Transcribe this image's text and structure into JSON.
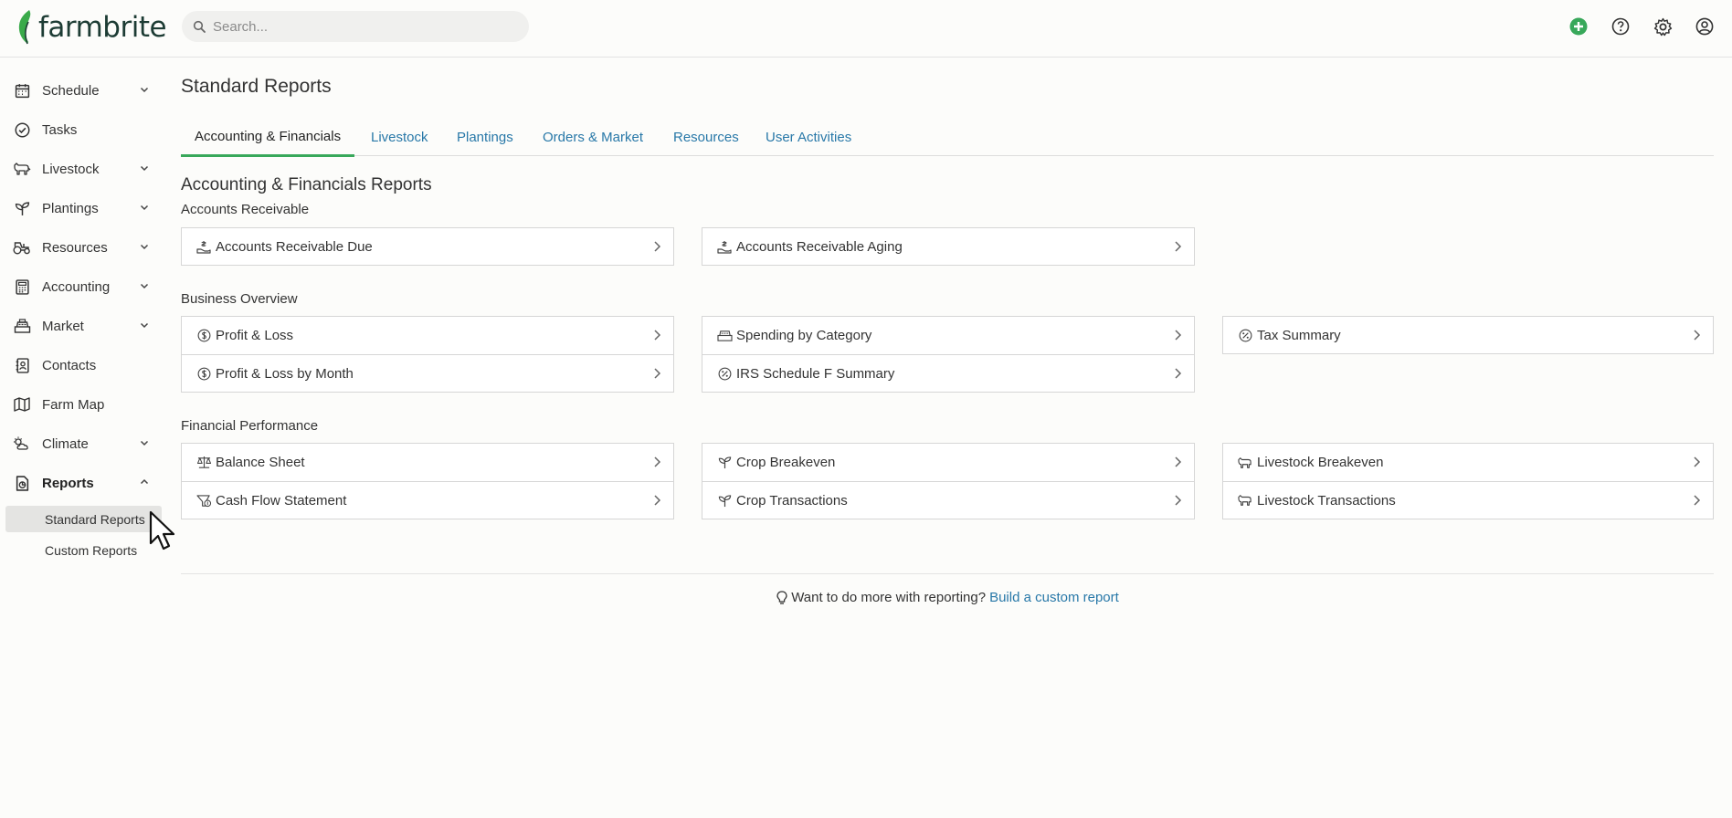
{
  "brand": {
    "name": "farmbrite",
    "leaf_color": "#3aaa4a"
  },
  "search": {
    "placeholder": "Search..."
  },
  "top_icons": [
    "add-circle-icon",
    "help-icon",
    "settings-icon",
    "user-icon"
  ],
  "sidebar": {
    "items": [
      {
        "label": "Schedule",
        "icon": "calendar-icon",
        "has_chevron": true
      },
      {
        "label": "Tasks",
        "icon": "check-circle-icon",
        "has_chevron": false
      },
      {
        "label": "Livestock",
        "icon": "livestock-icon",
        "has_chevron": true
      },
      {
        "label": "Plantings",
        "icon": "sprout-icon",
        "has_chevron": true
      },
      {
        "label": "Resources",
        "icon": "tractor-icon",
        "has_chevron": true
      },
      {
        "label": "Accounting",
        "icon": "calculator-icon",
        "has_chevron": true
      },
      {
        "label": "Market",
        "icon": "register-icon",
        "has_chevron": true
      },
      {
        "label": "Contacts",
        "icon": "contact-book-icon",
        "has_chevron": false
      },
      {
        "label": "Farm Map",
        "icon": "map-icon",
        "has_chevron": false
      },
      {
        "label": "Climate",
        "icon": "weather-icon",
        "has_chevron": true
      },
      {
        "label": "Reports",
        "icon": "report-icon",
        "has_chevron": true,
        "expanded": true
      }
    ],
    "sub_items": [
      {
        "label": "Standard Reports",
        "selected": true
      },
      {
        "label": "Custom Reports",
        "selected": false
      }
    ]
  },
  "page": {
    "title": "Standard Reports",
    "tabs": [
      {
        "label": "Accounting & Financials",
        "active": true
      },
      {
        "label": "Livestock"
      },
      {
        "label": "Plantings"
      },
      {
        "label": "Orders & Market"
      },
      {
        "label": "Resources"
      },
      {
        "label": "User Activities"
      }
    ],
    "section_title": "Accounting & Financials Reports",
    "groups": [
      {
        "title": "Accounts Receivable",
        "cards": [
          [
            {
              "label": "Accounts Receivable Due",
              "icon": "hand-money-icon"
            }
          ],
          [
            {
              "label": "Accounts Receivable Aging",
              "icon": "hand-money-icon"
            }
          ]
        ]
      },
      {
        "title": "Business Overview",
        "cards": [
          [
            {
              "label": "Profit & Loss",
              "icon": "dollar-circle-icon"
            },
            {
              "label": "Profit & Loss by Month",
              "icon": "dollar-circle-icon"
            }
          ],
          [
            {
              "label": "Spending by Category",
              "icon": "cash-register-icon"
            },
            {
              "label": "IRS Schedule F Summary",
              "icon": "percent-circle-icon"
            }
          ],
          [
            {
              "label": "Tax Summary",
              "icon": "percent-circle-icon"
            }
          ]
        ]
      },
      {
        "title": "Financial Performance",
        "cards": [
          [
            {
              "label": "Balance Sheet",
              "icon": "balance-scale-icon"
            },
            {
              "label": "Cash Flow Statement",
              "icon": "cash-flow-icon"
            }
          ],
          [
            {
              "label": "Crop Breakeven",
              "icon": "sprout-icon"
            },
            {
              "label": "Crop Transactions",
              "icon": "sprout-icon"
            }
          ],
          [
            {
              "label": "Livestock Breakeven",
              "icon": "livestock-icon"
            },
            {
              "label": "Livestock Transactions",
              "icon": "livestock-icon"
            }
          ]
        ]
      }
    ],
    "footer": {
      "text": "Want to do more with reporting?",
      "link": "Build a custom report",
      "icon": "lightbulb-icon"
    }
  },
  "colors": {
    "accent_green": "#38a85a",
    "link_blue": "#2878a8",
    "brand_dark": "#1d3c34"
  }
}
